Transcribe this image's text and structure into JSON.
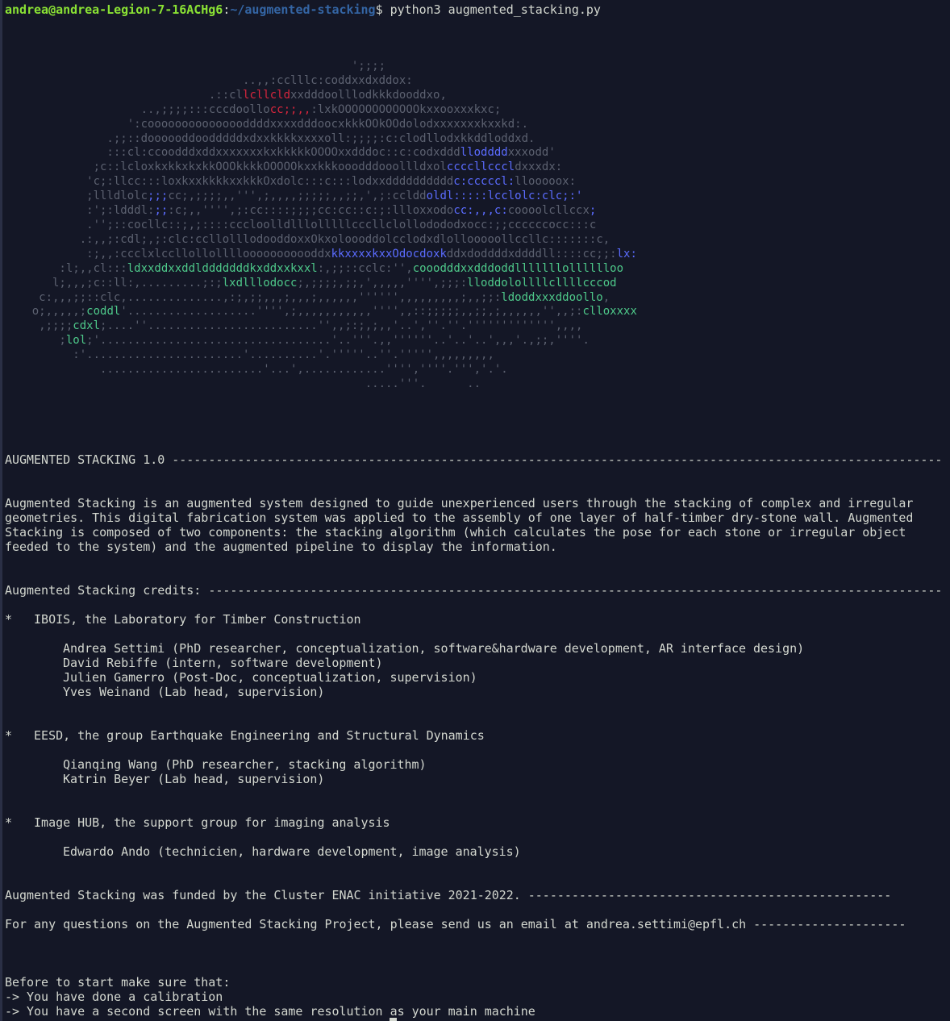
{
  "terminal": {
    "prompt_user": "andrea@andrea-Legion-7-16ACHg6",
    "prompt_sep": ":",
    "prompt_path": "~/augmented-stacking",
    "prompt_symbol": "$ ",
    "command": "python3 augmented_stacking.py"
  },
  "ascii_art": [
    [
      [
        "dim",
        "                                                   ';;;;"
      ]
    ],
    [
      [
        "dim",
        "                                   ..,,:cclllc:coddxxdxddox:"
      ]
    ],
    [
      [
        "dim",
        "                              .::cl"
      ],
      [
        "red",
        "lcllcld"
      ],
      [
        "dim",
        "xxdddoolllodkkkdooddxo,"
      ]
    ],
    [
      [
        "dim",
        "                    ..,;;;;:::cccdoollo"
      ],
      [
        "red",
        "cc;;,,"
      ],
      [
        "dim",
        ":lxkOOOOOOOOOOOOkxxooxxxkxc;"
      ]
    ],
    [
      [
        "dim",
        "                  ':cooooooooooooooddddxxxxdddoocxkkkOOkOOdolodxxxxxxxkxxkd:."
      ]
    ],
    [
      [
        "dim",
        "               .;;::doooooddoodddddxdxxkkkkxxxxoll:;;;;:c:clodllodxkkddloddxd."
      ]
    ],
    [
      [
        "dim",
        "               :::cl:ccoodddxddxxxxxxxkxkkkkkOOOOxxdddoc::c:codxddd"
      ],
      [
        "blue",
        "llodddd"
      ],
      [
        "dim",
        "xxxodd'"
      ]
    ],
    [
      [
        "dim",
        "             ;c::lcloxkxkkxkxkkOOOkkkkOOOOOkxxkkkooodddoooll"
      ],
      [
        "dim",
        "ldxol"
      ],
      [
        "blue",
        "ccccllcccl"
      ],
      [
        "dim",
        "dxxxdx:"
      ]
    ],
    [
      [
        "dim",
        "            'c;:llcc:::loxkxxkkkkxxkkkOxdolc:::c:::lodxxdddddddddd"
      ],
      [
        "blue",
        "c:cccccl:"
      ],
      [
        "dim",
        "llooooox:"
      ]
    ],
    [
      [
        "dim",
        "            ;llldlolc"
      ],
      [
        "blue",
        ";;;"
      ],
      [
        "dim",
        "cc;,;;;;,,''',;,,,,;;;;;,,;;,',;:ccldd"
      ],
      [
        "blue",
        "oldl:::::lcclolc:clc;:'"
      ]
    ],
    [
      [
        "dim",
        "            :';:ldddl:"
      ],
      [
        "blue",
        ";;"
      ],
      [
        "dim",
        ":c;,,'''',;:cc::::;;;;cc:cc::c:;:llloxxodo"
      ],
      [
        "blue",
        "cc:,,,c:"
      ],
      [
        "dim",
        "coooolcllccx"
      ],
      [
        "blue",
        ";"
      ]
    ],
    [
      [
        "dim",
        "            .'';::cocllc::;,;::::ccclooll"
      ],
      [
        "dim",
        "dlllolllllccc"
      ],
      [
        "dim",
        "llclollododo"
      ],
      [
        "dim",
        "dxocc:;;ccccccocc:::c"
      ]
    ],
    [
      [
        "dim",
        "           .:,,;:cdl;,;:clc:cc"
      ],
      [
        "dim",
        "llolllodooddoxx"
      ],
      [
        "dim",
        "Okxoloooddolccl"
      ],
      [
        "dim",
        "odxdlollooooollccllc:::::::c,"
      ]
    ],
    [
      [
        "dim",
        "            :;,,:ccclxlccllollollllooooooooooddx"
      ],
      [
        "blue",
        "kkxxxxkxxOdocdoxk"
      ],
      [
        "dim",
        "ddxdoddddxddddll::::cc;;:"
      ],
      [
        "blue",
        "lx:"
      ]
    ],
    [
      [
        "dim",
        "        :l;,,cl:::"
      ],
      [
        "green",
        "ldxxddxxddldddddddkxddxxkxxl"
      ],
      [
        "dim",
        ":,;;::cclc:'',"
      ],
      [
        "green",
        "cooodddxxdddoddlllllllolllllloo"
      ]
    ],
    [
      [
        "dim",
        "       l;,,,;c::ll:,.........;:;"
      ],
      [
        "green",
        "lxdlllodocc"
      ],
      [
        "dim",
        ";,;;;;,;;,',,,,,'''',;;;:"
      ],
      [
        "green",
        "lloddolollllcllllcccod"
      ]
    ],
    [
      [
        "dim",
        "     c:,,,;;::clc,..............,:;,;;,,,;,,,;,,,,,,'''''',,,,,,,,,;,,;;:"
      ],
      [
        "green",
        "ldoddxxxddoollo"
      ],
      [
        "dim",
        ","
      ]
    ],
    [
      [
        "dim",
        "    o;,,,,,;"
      ],
      [
        "green",
        "coddl"
      ],
      [
        "dim",
        "'...................'''',;,,,,,,,,,,,'''',,::;;;;;,,;;,;,,,,,,'',,;:"
      ],
      [
        "green",
        "clloxxxx"
      ]
    ],
    [
      [
        "dim",
        "     ,;;;;"
      ],
      [
        "green",
        "cdxl"
      ],
      [
        "dim",
        ";....''.........................'',,;:;,;,,'..',''.''.''''''''''''',,,,"
      ]
    ],
    [
      [
        "dim",
        "        ;"
      ],
      [
        "green",
        "lol"
      ],
      [
        "dim",
        ";'..................................'..'''.,,''''''..'..'..',,,'.,;;,''''."
      ]
    ],
    [
      [
        "dim",
        "          :'.......................'..........'.'''''..''.''''',,,,,,,,,"
      ]
    ],
    [
      [
        "dim",
        "              ........................'...',............'''',''''.''','.'."
      ]
    ],
    [
      [
        "dim",
        "                                                     .....'''.      .."
      ]
    ]
  ],
  "banner": {
    "title": "AUGMENTED STACKING 1.0",
    "title_rule": " ----------------------------------------------------------------------------------------------------------",
    "description_lines": [
      "Augmented Stacking is an augmented system designed to guide unexperienced users through the stacking of complex and irregular",
      "geometries. This digital fabrication system was applied to the assembly of one layer of half-timber dry-stone wall. Augmented",
      "Stacking is composed of two components: the stacking algorithm (which calculates the pose for each stone or irregular object",
      "feeded to the system) and the augmented pipeline to display the information."
    ],
    "credits_heading": "Augmented Stacking credits: ",
    "credits_rule": "-----------------------------------------------------------------------------------------------------",
    "groups": [
      {
        "bullet": "*   IBOIS, the Laboratory for Timber Construction",
        "members": [
          "Andrea Settimi (PhD researcher, conceptualization, software&hardware development, AR interface design)",
          "David Rebiffe (intern, software development)",
          "Julien Gamerro (Post-Doc, conceptualization, supervision)",
          "Yves Weinand (Lab head, supervision)"
        ]
      },
      {
        "bullet": "*   EESD, the group Earthquake Engineering and Structural Dynamics",
        "members": [
          "Qianqing Wang (PhD researcher, stacking algorithm)",
          "Katrin Beyer (Lab head, supervision)"
        ]
      },
      {
        "bullet": "*   Image HUB, the support group for imaging analysis",
        "members": [
          "Edwardo Ando (technicien, hardware development, image analysis)"
        ]
      }
    ],
    "funding_line": "Augmented Stacking was funded by the Cluster ENAC initiative 2021-2022. ",
    "funding_rule": "--------------------------------------------------",
    "contact_line": "For any questions on the Augmented Stacking Project, please send us an email at andrea.settimi@epfl.ch ",
    "contact_rule": "---------------------",
    "checklist_heading": "Before to start make sure that:",
    "checklist": [
      "-> You have done a calibration",
      "-> You have a second screen with the same resolution as your main machine"
    ]
  },
  "colors": {
    "background": "#141726",
    "foreground": "#d3d7cf",
    "prompt_user": "#8ae234",
    "prompt_path": "#3465a4",
    "art_red": "#d7263d",
    "art_blue": "#5b6cff",
    "art_green": "#4ec98a"
  }
}
